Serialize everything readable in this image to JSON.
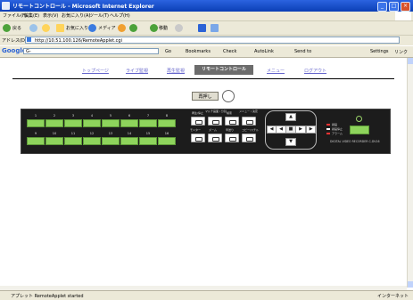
{
  "window": {
    "title": "リモートコントロール - Microsoft Internet Explorer",
    "controls": [
      "_",
      "□",
      "×"
    ]
  },
  "menu": [
    "ファイル(F)",
    "編集(E)",
    "表示(V)",
    "お気に入り(A)",
    "ツール(T)",
    "ヘルプ(H)"
  ],
  "toolbar": {
    "back": "戻る",
    "favorites": "お気に入り",
    "media": "メディア",
    "go_label": "移動"
  },
  "address": {
    "label": "アドレス(D)",
    "value": "http://10.51.100.126/RemoteApplet.cgi"
  },
  "google_toolbar": {
    "logo": "Google",
    "search_value": "G-",
    "go": "Go",
    "bookmarks": "Bookmarks",
    "check": "Check",
    "autolink": "AutoLink",
    "sendto": "Send to",
    "settings": "Settings",
    "links": "リンク"
  },
  "site_nav": {
    "items": [
      "トップページ",
      "ライブ監視",
      "再生監視",
      "リモートコントロール",
      "メニュー",
      "ログアウト"
    ],
    "active": "リモートコントロール"
  },
  "remote": {
    "refresh_label": "再押し",
    "channels": [
      "1",
      "2",
      "3",
      "4",
      "5",
      "6",
      "7",
      "8",
      "9",
      "10",
      "11",
      "12",
      "13",
      "14",
      "15",
      "16"
    ],
    "func_top_labels": [
      "再生/停止",
      "マルチ画面 / 分割",
      "検索",
      "メニュー / 決定"
    ],
    "func_bottom_labels": [
      "モニター",
      "ズーム",
      "早送り",
      "コピー/スチル"
    ],
    "legend": [
      "録画",
      "録画停止",
      "アラーム"
    ],
    "model": "DIGITAL VIDEO RECORDER C-DV16"
  },
  "status": {
    "text": "アプレット RemoteApplet started",
    "zone": "インターネット"
  },
  "colors": {
    "titlebar": "#0b3fb5",
    "nav_active_bg": "#6c6c6c",
    "button_green": "#8ed45c",
    "remote_bg": "#1c1c1c"
  }
}
